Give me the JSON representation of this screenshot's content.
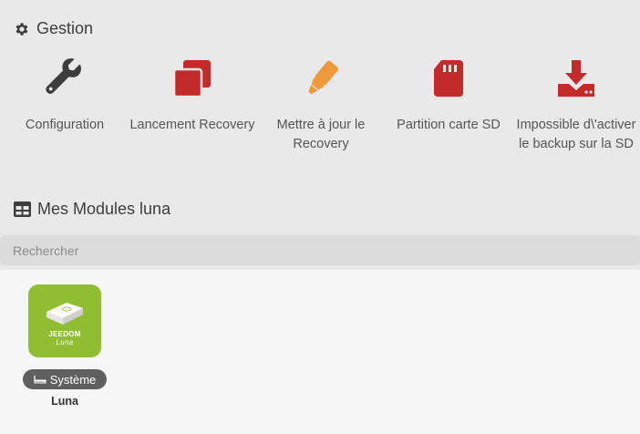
{
  "gestion": {
    "title": "Gestion",
    "title_icon": "gear-icon",
    "actions": [
      {
        "label": "Configuration",
        "icon": "wrench-icon",
        "color": "#3d3d3d"
      },
      {
        "label": "Lancement Recovery",
        "icon": "copy-icon",
        "color": "#c42a2a"
      },
      {
        "label": "Mettre à jour le Recovery",
        "icon": "highlighter-icon",
        "color": "#ee9a3b"
      },
      {
        "label": "Partition carte SD",
        "icon": "sd-card-icon",
        "color": "#c42a2a"
      },
      {
        "label": "Impossible d\\'activer le backup sur la SD",
        "icon": "download-drive-icon",
        "color": "#c42a2a"
      }
    ]
  },
  "modules": {
    "title": "Mes Modules luna",
    "title_icon": "table-icon",
    "search_placeholder": "Rechercher",
    "items": [
      {
        "logo_text": "JEEDOM",
        "logo_subtext": "Luna",
        "logo_color": "#8fbe33",
        "category": "Système",
        "category_icon": "router-icon",
        "name": "Luna"
      }
    ]
  }
}
